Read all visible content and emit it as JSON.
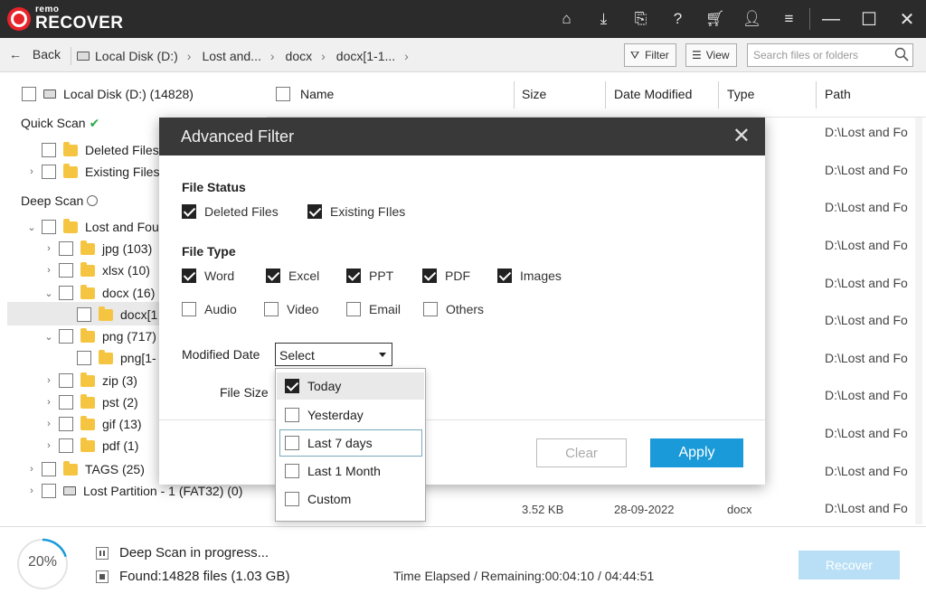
{
  "app": {
    "logo_small": "remo",
    "logo_big": "RECOVER"
  },
  "nav": {
    "back": "Back",
    "crumbs": [
      "Local Disk (D:)",
      "Lost and...",
      "docx",
      "docx[1-1..."
    ],
    "filter": "Filter",
    "view": "View",
    "search_placeholder": "Search files or folders"
  },
  "tree": {
    "root": "Local Disk (D:) (14828)",
    "quick_scan": "Quick Scan",
    "quick_items": [
      "Deleted Files",
      "Existing Files"
    ],
    "deep_scan": "Deep Scan",
    "lost_found": "Lost and Fou",
    "children": [
      "jpg (103)",
      "xlsx (10)",
      "docx (16)",
      "docx[1",
      "png (717)",
      "png[1-",
      "zip (3)",
      "pst (2)",
      "gif (13)",
      "pdf (1)"
    ],
    "tags": "TAGS (25)",
    "lost_partition": "Lost Partition - 1 (FAT32) (0)"
  },
  "table": {
    "columns": [
      "Name",
      "Size",
      "Date Modified",
      "Type",
      "Path"
    ],
    "path_values": [
      "D:\\Lost and Fo",
      "D:\\Lost and Fo",
      "D:\\Lost and Fo",
      "D:\\Lost and Fo",
      "D:\\Lost and Fo",
      "D:\\Lost and Fo",
      "D:\\Lost and Fo",
      "D:\\Lost and Fo",
      "D:\\Lost and Fo",
      "D:\\Lost and Fo",
      "D:\\Lost and Fo"
    ],
    "last_row": {
      "size": "3.52 KB",
      "date": "28-09-2022",
      "type": "docx"
    }
  },
  "status": {
    "progress": "20%",
    "progress_fraction": 0.2,
    "scan_text": "Deep Scan in progress...",
    "found": "Found:14828 files (1.03 GB)",
    "elapsed_label": "Time Elapsed / Remaining:",
    "elapsed_value": "00:04:10 / 04:44:51",
    "recover": "Recover"
  },
  "modal": {
    "title": "Advanced Filter",
    "file_status_label": "File Status",
    "file_status": [
      {
        "label": "Deleted Files",
        "checked": true
      },
      {
        "label": "Existing FIles",
        "checked": true
      }
    ],
    "file_type_label": "File Type",
    "file_types_row1": [
      {
        "label": "Word",
        "checked": true
      },
      {
        "label": "Excel",
        "checked": true
      },
      {
        "label": "PPT",
        "checked": true
      },
      {
        "label": "PDF",
        "checked": true
      },
      {
        "label": "Images",
        "checked": true
      }
    ],
    "file_types_row2": [
      {
        "label": "Audio",
        "checked": false
      },
      {
        "label": "Video",
        "checked": false
      },
      {
        "label": "Email",
        "checked": false
      },
      {
        "label": "Others",
        "checked": false
      }
    ],
    "modified_date_label": "Modified Date",
    "select_value": "Select",
    "file_size_label": "File Size",
    "clear": "Clear",
    "apply": "Apply"
  },
  "dropdown": {
    "options": [
      {
        "label": "Today",
        "checked": true
      },
      {
        "label": "Yesterday",
        "checked": false
      },
      {
        "label": "Last 7 days",
        "checked": false
      },
      {
        "label": "Last 1 Month",
        "checked": false
      },
      {
        "label": "Custom",
        "checked": false
      }
    ]
  }
}
